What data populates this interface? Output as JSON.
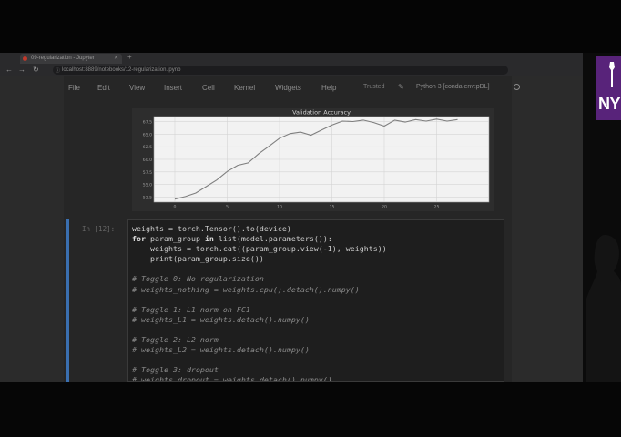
{
  "browser": {
    "tab_title": "09-regularization - Jupyter",
    "url": "localhost:8889/notebooks/12-regularization.ipynb"
  },
  "menu": {
    "items": [
      "File",
      "Edit",
      "View",
      "Insert",
      "Cell",
      "Kernel",
      "Widgets",
      "Help"
    ],
    "trusted": "Trusted",
    "kernel": "Python 3 [conda env:pDL]"
  },
  "chart_data": {
    "type": "line",
    "title": "Validation Accuracy",
    "xlabel": "",
    "ylabel": "",
    "xlim": [
      -2,
      30
    ],
    "ylim": [
      51.5,
      68.5
    ],
    "xticks": [
      "0",
      "5",
      "10",
      "15",
      "20",
      "25"
    ],
    "yticks": [
      "52.5",
      "55.0",
      "57.5",
      "60.0",
      "62.5",
      "65.0",
      "67.5"
    ],
    "grid": true,
    "series": [
      {
        "color": "#7f7f7f",
        "x": [
          0,
          1,
          2,
          3,
          4,
          5,
          6,
          7,
          8,
          9,
          10,
          11,
          12,
          13,
          14,
          15,
          16,
          17,
          18,
          19,
          20,
          21,
          22,
          23,
          24,
          25,
          26,
          27
        ],
        "y": [
          52.1,
          52.6,
          53.3,
          54.6,
          55.9,
          57.6,
          58.8,
          59.3,
          61.1,
          62.6,
          64.2,
          65.1,
          65.4,
          64.8,
          65.8,
          66.8,
          67.6,
          67.5,
          67.8,
          67.3,
          66.6,
          67.8,
          67.4,
          67.9,
          67.6,
          68.0,
          67.6,
          67.9
        ]
      }
    ]
  },
  "cell": {
    "prompt": "In [12]:",
    "lines": [
      {
        "segments": [
          {
            "cls": "",
            "text": "weights = torch.Tensor().to(device)"
          }
        ]
      },
      {
        "segments": [
          {
            "cls": "kw",
            "text": "for"
          },
          {
            "cls": "",
            "text": " param_group "
          },
          {
            "cls": "kw",
            "text": "in"
          },
          {
            "cls": "",
            "text": " list(model.parameters()):"
          }
        ]
      },
      {
        "segments": [
          {
            "cls": "",
            "text": "    weights = torch.cat((param_group.view(-1), weights))"
          }
        ]
      },
      {
        "segments": [
          {
            "cls": "",
            "text": "    print(param_group.size())"
          }
        ]
      },
      {
        "segments": [
          {
            "cls": "",
            "text": ""
          }
        ]
      },
      {
        "segments": [
          {
            "cls": "cm",
            "text": "# Toggle 0: No regularization"
          }
        ]
      },
      {
        "segments": [
          {
            "cls": "cm",
            "text": "# weights_nothing = weights.cpu().detach().numpy()"
          }
        ]
      },
      {
        "segments": [
          {
            "cls": "",
            "text": ""
          }
        ]
      },
      {
        "segments": [
          {
            "cls": "cm",
            "text": "# Toggle 1: L1 norm on FC1"
          }
        ]
      },
      {
        "segments": [
          {
            "cls": "cm",
            "text": "# weights_L1 = weights.detach().numpy()"
          }
        ]
      },
      {
        "segments": [
          {
            "cls": "",
            "text": ""
          }
        ]
      },
      {
        "segments": [
          {
            "cls": "cm",
            "text": "# Toggle 2: L2 norm"
          }
        ]
      },
      {
        "segments": [
          {
            "cls": "cm",
            "text": "# weights_L2 = weights.detach().numpy()"
          }
        ]
      },
      {
        "segments": [
          {
            "cls": "",
            "text": ""
          }
        ]
      },
      {
        "segments": [
          {
            "cls": "cm",
            "text": "# Toggle 3: dropout"
          }
        ]
      },
      {
        "segments": [
          {
            "cls": "cm",
            "text": "# weights_dropout = weights.detach().numpy()"
          }
        ]
      }
    ]
  },
  "logo_text": "NYU"
}
